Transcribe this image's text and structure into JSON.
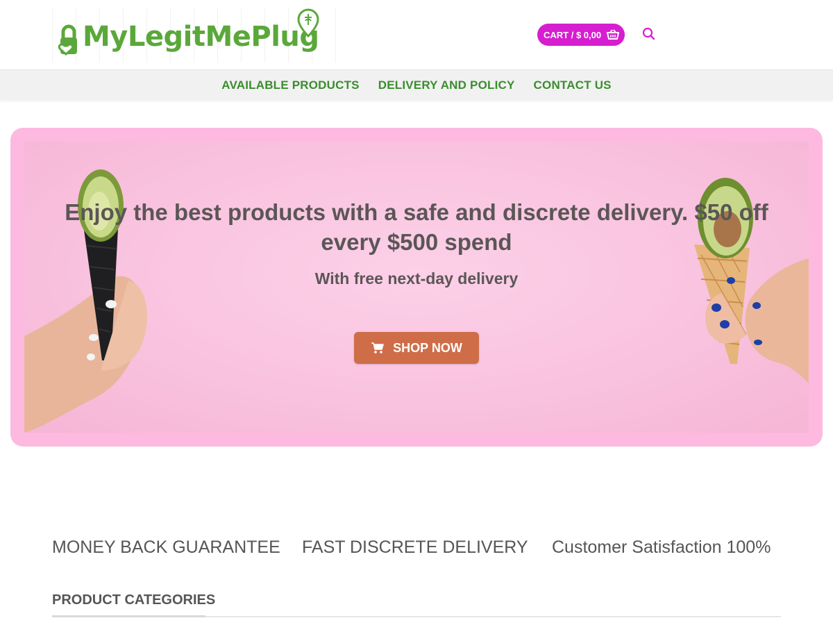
{
  "header": {
    "logo_text": "MyLegitMePlug",
    "cart_label": "CART / $ 0,00",
    "icons": {
      "cart": "basket-icon",
      "search": "search-icon"
    }
  },
  "nav": {
    "items": [
      {
        "label": "AVAILABLE PRODUCTS"
      },
      {
        "label": "DELIVERY AND POLICY"
      },
      {
        "label": "CONTACT US"
      }
    ]
  },
  "hero": {
    "title": "Enjoy the best products with a safe and discrete delivery. $50 off every $500 spend",
    "subtitle": "With free next-day delivery",
    "button_label": "SHOP NOW",
    "button_icon": "cart-icon"
  },
  "features": [
    {
      "label": "MONEY BACK GUARANTEE"
    },
    {
      "label": "FAST DISCRETE DELIVERY"
    },
    {
      "label": "Customer Satisfaction 100%"
    }
  ],
  "categories": {
    "title": "PRODUCT CATEGORIES"
  },
  "colors": {
    "brand_green": "#5aa83a",
    "nav_green": "#3a8d2e",
    "cart_magenta": "#d61ed0",
    "hero_pink": "#fdb9e0",
    "shop_button": "#cf6d48",
    "text_gray": "#555555"
  }
}
